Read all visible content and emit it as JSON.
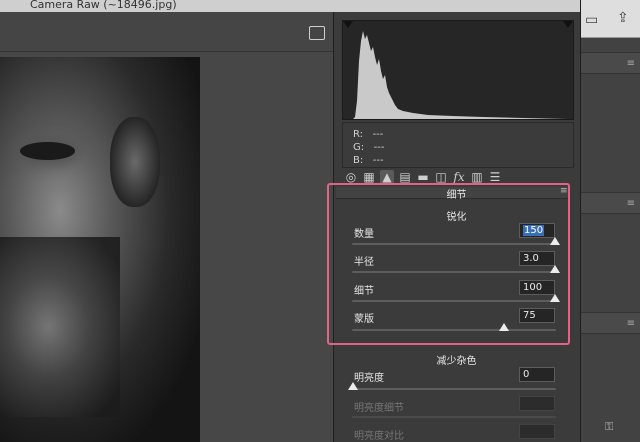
{
  "window": {
    "title": "Camera Raw (~18496.jpg)"
  },
  "rgb_readout": [
    {
      "channel": "R:",
      "value": "---"
    },
    {
      "channel": "G:",
      "value": "---"
    },
    {
      "channel": "B:",
      "value": "---"
    }
  ],
  "toolbar_icons": [
    "aperture-icon",
    "grid-icon",
    "mountains-icon",
    "hsl-icon",
    "split-toning-icon",
    "lens-icon",
    "fx-icon",
    "camera-calibration-icon",
    "sliders-icon"
  ],
  "detail_panel": {
    "title": "细节",
    "sharpening": {
      "heading": "锐化",
      "rows": [
        {
          "label": "数量",
          "value": "150",
          "level": 1.0
        },
        {
          "label": "半径",
          "value": "3.0",
          "level": 1.0
        },
        {
          "label": "细节",
          "value": "100",
          "level": 1.0
        },
        {
          "label": "蒙版",
          "value": "75",
          "level": 0.75
        }
      ]
    },
    "noise_reduction": {
      "heading": "减少杂色",
      "rows": [
        {
          "label": "明亮度",
          "value": "0",
          "level": 0.0
        },
        {
          "label": "明亮度细节",
          "value": "",
          "dim": true
        },
        {
          "label": "明亮度对比",
          "value": "",
          "dim": true
        }
      ]
    }
  },
  "colors": {
    "highlight": "#e06484",
    "selection": "#3b6fb5"
  }
}
